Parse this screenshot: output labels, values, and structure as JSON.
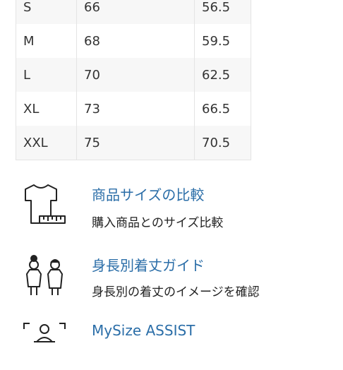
{
  "size_table": {
    "rows": [
      {
        "size": "S",
        "col2": "66",
        "col3": "56.5"
      },
      {
        "size": "M",
        "col2": "68",
        "col3": "59.5"
      },
      {
        "size": "L",
        "col2": "70",
        "col3": "62.5"
      },
      {
        "size": "XL",
        "col2": "73",
        "col3": "66.5"
      },
      {
        "size": "XXL",
        "col2": "75",
        "col3": "70.5"
      }
    ]
  },
  "links": [
    {
      "title": "商品サイズの比較",
      "description": "購入商品とのサイズ比較",
      "icon": "tshirt-ruler-icon"
    },
    {
      "title": "身長別着丈ガイド",
      "description": "身長別の着丈のイメージを確認",
      "icon": "people-height-icon"
    },
    {
      "title": "MySize ASSIST",
      "description": "",
      "icon": "body-scan-icon"
    }
  ],
  "colors": {
    "link": "#2b6ea8",
    "stripe": "#f7f7f7",
    "border": "#e4e4e4"
  }
}
